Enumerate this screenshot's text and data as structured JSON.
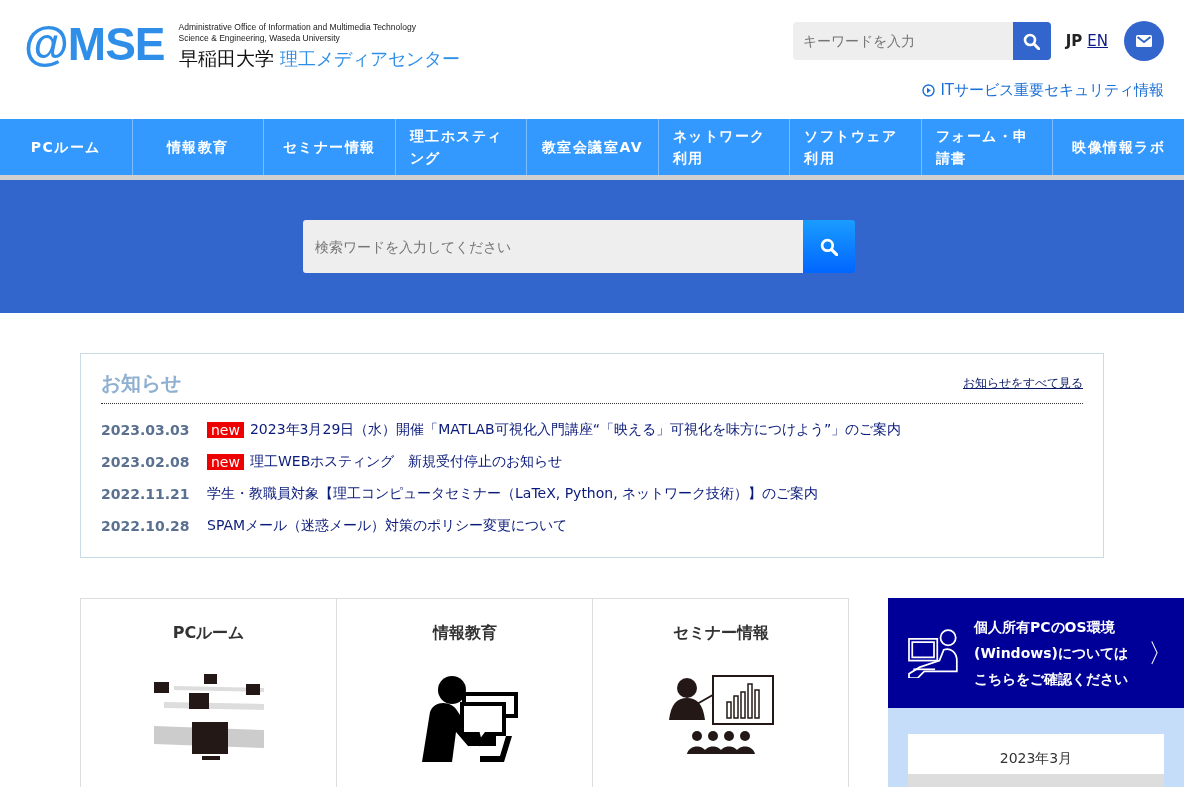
{
  "header": {
    "logo": "@MSE",
    "subtitle_lines": [
      "Administrative Office of Information and Multimedia Technology",
      "Science & Engineering, Waseda University"
    ],
    "university": "早稲田大学",
    "center_name": "理工メディアセンター",
    "search": {
      "placeholder": "キーワードを入力"
    },
    "languages": [
      {
        "label": "JP",
        "selected": true
      },
      {
        "label": "EN",
        "selected": false
      }
    ],
    "security_link": "ITサービス重要セキュリティ情報"
  },
  "nav": [
    "PCルーム",
    "情報教育",
    "セミナー情報",
    "理工ホスティング",
    "教室会議室AV",
    "ネットワーク利用",
    "ソフトウェア利用",
    "フォーム・申請書",
    "映像情報ラボ"
  ],
  "hero_search": {
    "placeholder": "検索ワードを入力してください"
  },
  "news": {
    "title": "お知らせ",
    "view_all": "お知らせをすべて見る",
    "items": [
      {
        "date": "2023.03.03",
        "badge": "new",
        "title": "2023年3月29日（水）開催「MATLAB可視化入門講座“「映える」可視化を味方につけよう”」のご案内"
      },
      {
        "date": "2023.02.08",
        "badge": "new",
        "title": "理工WEBホスティング　新規受付停止のお知らせ"
      },
      {
        "date": "2022.11.21",
        "title": "学生・教職員対象【理工コンピュータセミナー（LaTeX, Python, ネットワーク技術）】のご案内"
      },
      {
        "date": "2022.10.28",
        "title": "SPAMメール（迷惑メール）対策のポリシー変更について"
      }
    ]
  },
  "cards": [
    {
      "title": "PCルーム",
      "kind": "pcroom"
    },
    {
      "title": "情報教育",
      "kind": "education"
    },
    {
      "title": "セミナー情報",
      "kind": "seminar"
    }
  ],
  "banner": {
    "lines": [
      "個人所有PCのOS環境",
      "(Windows)については",
      "こちらをご確認ください"
    ],
    "arrow": "〉"
  },
  "calendar": {
    "month": "2023年3月"
  }
}
